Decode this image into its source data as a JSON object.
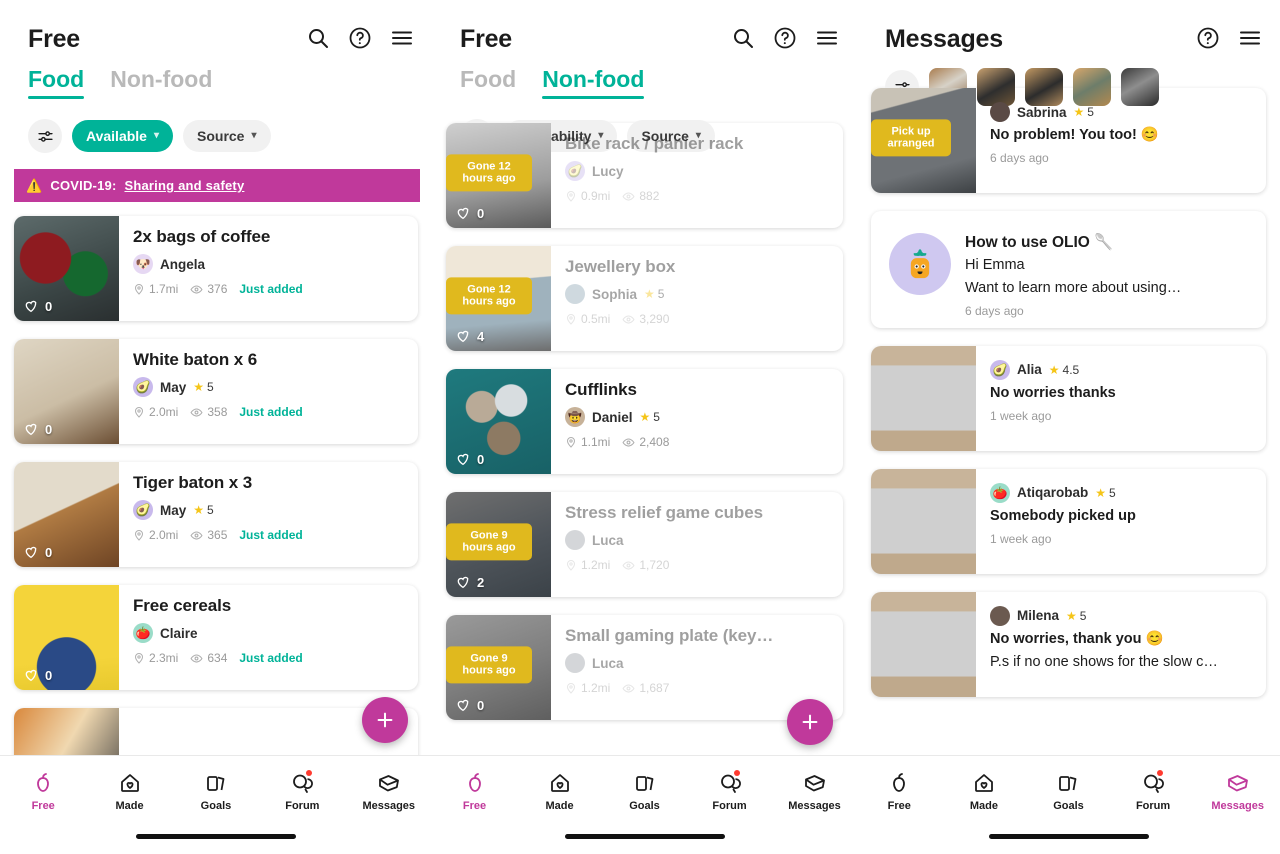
{
  "brand": {
    "teal": "#00B398",
    "magenta": "#C0399B",
    "yellow": "#E0B91E",
    "grey": "#9a9a9a"
  },
  "panels": {
    "free_food": {
      "title": "Free",
      "tabs": [
        {
          "label": "Food",
          "active": true
        },
        {
          "label": "Non-food",
          "active": false
        }
      ],
      "filters": {
        "toggle_icon": "sliders-icon",
        "availability": {
          "label": "Available",
          "active": true
        },
        "source": {
          "label": "Source",
          "active": false
        }
      },
      "banner": {
        "prefix": "COVID-19:",
        "link": "Sharing and safety",
        "icon": "warning-icon"
      },
      "items": [
        {
          "title": "2x bags of coffee",
          "user": "Angela",
          "rating": "",
          "distance": "1.7mi",
          "views": "376",
          "status": "Just added",
          "likes": "0",
          "tag": ""
        },
        {
          "title": "White baton x 6",
          "user": "May",
          "rating": "5",
          "distance": "2.0mi",
          "views": "358",
          "status": "Just added",
          "likes": "0",
          "tag": ""
        },
        {
          "title": "Tiger baton x 3",
          "user": "May",
          "rating": "5",
          "distance": "2.0mi",
          "views": "365",
          "status": "Just added",
          "likes": "0",
          "tag": ""
        },
        {
          "title": "Free cereals",
          "user": "Claire",
          "rating": "",
          "distance": "2.3mi",
          "views": "634",
          "status": "Just added",
          "likes": "0",
          "tag": ""
        }
      ],
      "fab_label": "+",
      "nav": [
        {
          "label": "Free",
          "icon": "apple-icon",
          "active": true,
          "badge": false
        },
        {
          "label": "Made",
          "icon": "house-heart-icon",
          "active": false,
          "badge": false
        },
        {
          "label": "Goals",
          "icon": "cards-icon",
          "active": false,
          "badge": false
        },
        {
          "label": "Forum",
          "icon": "chat-bubbles-icon",
          "active": false,
          "badge": true
        },
        {
          "label": "Messages",
          "icon": "envelope-icon",
          "active": false,
          "badge": false
        }
      ]
    },
    "free_nonfood": {
      "title": "Free",
      "tabs": [
        {
          "label": "Food",
          "active": false
        },
        {
          "label": "Non-food",
          "active": true
        }
      ],
      "filters": {
        "toggle_icon": "sliders-icon",
        "availability": {
          "label": "Availability",
          "active": false
        },
        "source": {
          "label": "Source",
          "active": false
        }
      },
      "items": [
        {
          "title": "Bike rack / panier rack",
          "user": "Lucy",
          "rating": "",
          "distance": "0.9mi",
          "views": "882",
          "status": "",
          "likes": "0",
          "tag": "Gone 12 hours ago"
        },
        {
          "title": "Jewellery box",
          "user": "Sophia",
          "rating": "5",
          "distance": "0.5mi",
          "views": "3,290",
          "status": "",
          "likes": "4",
          "tag": "Gone 12 hours ago"
        },
        {
          "title": "Cufflinks",
          "user": "Daniel",
          "rating": "5",
          "distance": "1.1mi",
          "views": "2,408",
          "status": "",
          "likes": "0",
          "tag": ""
        },
        {
          "title": "Stress relief game cubes",
          "user": "Luca",
          "rating": "",
          "distance": "1.2mi",
          "views": "1,720",
          "status": "",
          "likes": "2",
          "tag": "Gone 9 hours ago"
        },
        {
          "title": "Small gaming plate (key…",
          "user": "Luca",
          "rating": "",
          "distance": "1.2mi",
          "views": "1,687",
          "status": "",
          "likes": "0",
          "tag": "Gone 9 hours ago"
        }
      ],
      "fab_label": "+",
      "nav": [
        {
          "label": "Free",
          "icon": "apple-icon",
          "active": true,
          "badge": false
        },
        {
          "label": "Made",
          "icon": "house-heart-icon",
          "active": false,
          "badge": false
        },
        {
          "label": "Goals",
          "icon": "cards-icon",
          "active": false,
          "badge": false
        },
        {
          "label": "Forum",
          "icon": "chat-bubbles-icon",
          "active": false,
          "badge": true
        },
        {
          "label": "Messages",
          "icon": "envelope-icon",
          "active": false,
          "badge": false
        }
      ]
    },
    "messages": {
      "title": "Messages",
      "chip_toggle_icon": "sliders-icon",
      "chips": [
        "listing-thumb-1",
        "listing-thumb-2",
        "listing-thumb-3",
        "listing-thumb-4",
        "listing-thumb-5"
      ],
      "threads": [
        {
          "user": "Sabrina",
          "rating": "5",
          "line1": "No problem! You too! 😊",
          "line2": "",
          "time": "6 days ago",
          "tag": "Pick up arranged",
          "kind": "thread"
        },
        {
          "user": "How to use OLIO 🥄",
          "rating": "",
          "line1": "Hi Emma",
          "line2": "Want to learn more about using…",
          "time": "6 days ago",
          "tag": "",
          "kind": "olio"
        },
        {
          "user": "Alia",
          "rating": "4.5",
          "line1": "No worries thanks",
          "line2": "",
          "time": "1 week ago",
          "tag": "",
          "kind": "thread"
        },
        {
          "user": "Atiqarobab",
          "rating": "5",
          "line1": "Somebody picked up",
          "line2": "",
          "time": "1 week ago",
          "tag": "",
          "kind": "thread"
        },
        {
          "user": "Milena",
          "rating": "5",
          "line1": "No worries, thank you 😊",
          "line2": "P.s if no one shows for the slow c…",
          "time": "",
          "tag": "",
          "kind": "thread"
        }
      ],
      "nav": [
        {
          "label": "Free",
          "icon": "apple-icon",
          "active": false,
          "badge": false
        },
        {
          "label": "Made",
          "icon": "house-heart-icon",
          "active": false,
          "badge": false
        },
        {
          "label": "Goals",
          "icon": "cards-icon",
          "active": false,
          "badge": false
        },
        {
          "label": "Forum",
          "icon": "chat-bubbles-icon",
          "active": false,
          "badge": true
        },
        {
          "label": "Messages",
          "icon": "envelope-icon",
          "active": true,
          "badge": false
        }
      ]
    }
  }
}
